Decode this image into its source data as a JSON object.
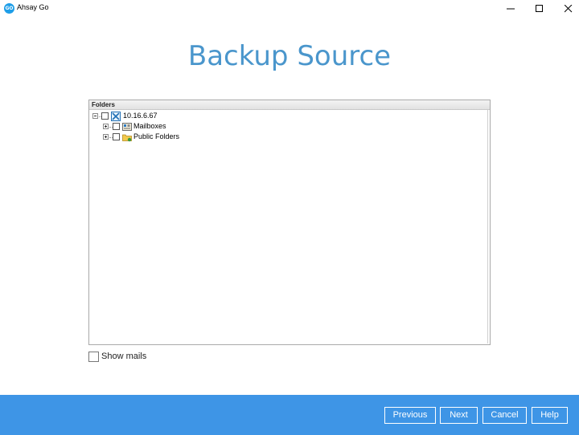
{
  "window": {
    "app_icon_text": "GO",
    "title": "Ahsay Go",
    "controls": [
      "minimize-icon",
      "maximize-icon",
      "close-icon"
    ]
  },
  "page": {
    "title": "Backup Source"
  },
  "tree": {
    "header": "Folders",
    "items": [
      {
        "label": "10.16.6.67",
        "icon": "exchange-server-icon",
        "expanded": true,
        "checked": false,
        "level": 0
      },
      {
        "label": "Mailboxes",
        "icon": "mailboxes-icon",
        "expanded": false,
        "checked": false,
        "level": 1
      },
      {
        "label": "Public Folders",
        "icon": "public-folders-icon",
        "expanded": false,
        "checked": false,
        "level": 1
      }
    ]
  },
  "options": {
    "show_mails_label": "Show mails",
    "show_mails_checked": false
  },
  "footer": {
    "previous_label": "Previous",
    "next_label": "Next",
    "cancel_label": "Cancel",
    "help_label": "Help"
  },
  "colors": {
    "accent": "#3e95e6",
    "title": "#4a96cc"
  }
}
